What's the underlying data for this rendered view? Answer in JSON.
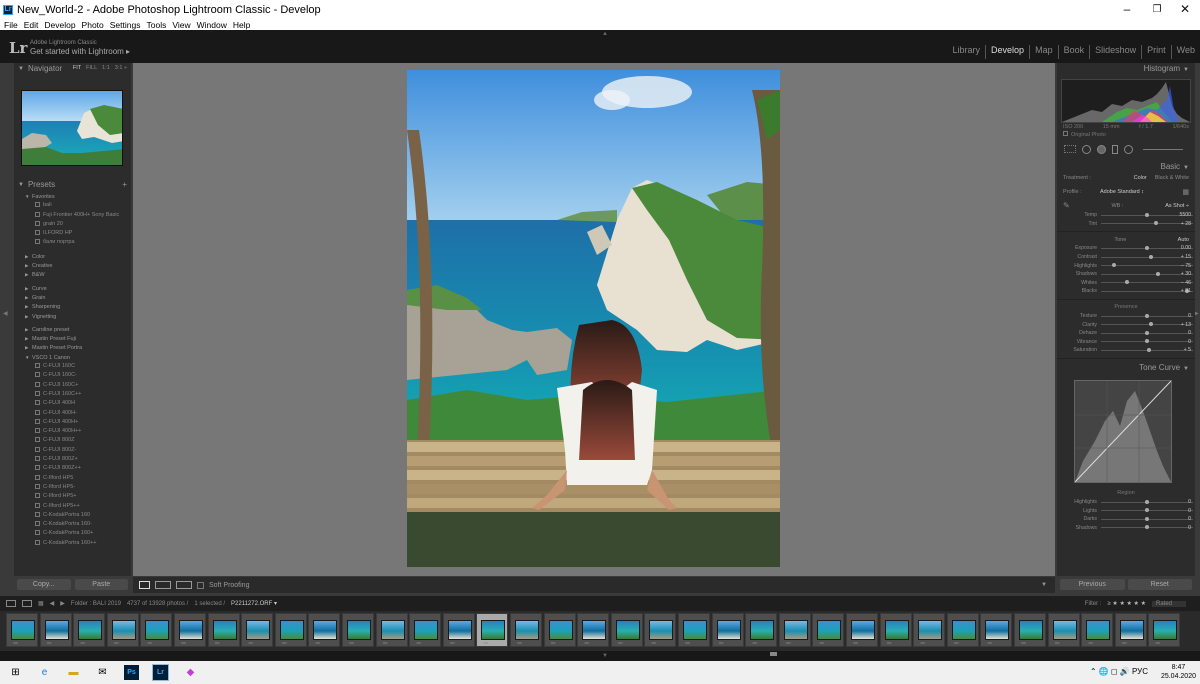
{
  "titlebar": {
    "icon": "Lr",
    "title": "New_World-2 - Adobe Photoshop Lightroom Classic - Develop",
    "minimize": "–",
    "maximize": "❐",
    "close": "✕"
  },
  "menu": [
    "File",
    "Edit",
    "Develop",
    "Photo",
    "Settings",
    "Tools",
    "View",
    "Window",
    "Help"
  ],
  "identity": {
    "logo": "Lr",
    "product": "Adobe Lightroom Classic",
    "cta": "Get started with Lightroom ▸"
  },
  "modules": [
    {
      "label": "Library",
      "active": false
    },
    {
      "label": "Develop",
      "active": true
    },
    {
      "label": "Map",
      "active": false
    },
    {
      "label": "Book",
      "active": false
    },
    {
      "label": "Slideshow",
      "active": false
    },
    {
      "label": "Print",
      "active": false
    },
    {
      "label": "Web",
      "active": false
    }
  ],
  "navigator": {
    "title": "Navigator",
    "opts": [
      "FIT",
      "FILL",
      "1:1",
      "3:1 ÷"
    ]
  },
  "presets": {
    "title": "Presets",
    "add": "+",
    "groups": [
      {
        "name": "Favorites",
        "open": true,
        "items": [
          "bali",
          "Fuji Frontier 400H+ Sony Basic",
          "grain 20",
          "ILFORD HP",
          "бали портра"
        ]
      },
      {
        "name": "Color",
        "open": false,
        "items": []
      },
      {
        "name": "Creative",
        "open": false,
        "items": []
      },
      {
        "name": "B&W",
        "open": false,
        "items": []
      },
      {
        "name": "Curve",
        "open": false,
        "items": []
      },
      {
        "name": "Grain",
        "open": false,
        "items": []
      },
      {
        "name": "Sharpening",
        "open": false,
        "items": []
      },
      {
        "name": "Vignetting",
        "open": false,
        "items": []
      },
      {
        "name": "Caroline preset",
        "open": false,
        "items": []
      },
      {
        "name": "Mastin Preset Fuji",
        "open": false,
        "items": []
      },
      {
        "name": "Mastin Preset Portra",
        "open": false,
        "items": []
      },
      {
        "name": "VSCO 1 Canon",
        "open": true,
        "items": [
          "C-FUJI 160C",
          "C-FUJI 160C-",
          "C-FUJI 160C+",
          "C-FUJI 160C++",
          "C-FUJI 400H",
          "C-FUJI 400H-",
          "C-FUJI 400H+",
          "C-FUJI 400H++",
          "C-FUJI 800Z",
          "C-FUJI 800Z-",
          "C-FUJI 800Z+",
          "C-FUJI 800Z++",
          "C-Ilford HP5",
          "C-Ilford HP5-",
          "C-Ilford HP5+",
          "C-Ilford HP5++",
          "C-KodakPortra 160",
          "C-KodakPortra 160-",
          "C-KodakPortra 160+",
          "C-KodakPortra 160++"
        ]
      }
    ]
  },
  "leftbuttons": {
    "copy": "Copy...",
    "paste": "Paste"
  },
  "toolbar": {
    "soft_proofing": "Soft Proofing",
    "view_icons": [
      "loupe",
      "before-after",
      "yy"
    ]
  },
  "histogram": {
    "title": "Histogram",
    "iso": "ISO 200",
    "focal": "15 mm",
    "aperture": "f / 1.7",
    "shutter": "1/640s",
    "original": "Original Photo"
  },
  "basic": {
    "title": "Basic",
    "treatment_label": "Treatment :",
    "treatment_color": "Color",
    "treatment_bw": "Black & White",
    "profile_label": "Profile :",
    "profile_value": "Adobe Standard ↕",
    "wb_label": "WB :",
    "wb_value": "As Shot ÷",
    "tone_label": "Tone",
    "tone_auto": "Auto",
    "presence_label": "Presence",
    "wb_sliders": [
      {
        "label": "Temp",
        "value": "5500",
        "pos": 0.5
      },
      {
        "label": "Tint",
        "value": "+ 28",
        "pos": 0.6
      }
    ],
    "tone_sliders": [
      {
        "label": "Exposure",
        "value": "0.00",
        "pos": 0.5
      },
      {
        "label": "Contrast",
        "value": "+ 15",
        "pos": 0.55
      },
      {
        "label": "Highlights",
        "value": "– 75",
        "pos": 0.12
      },
      {
        "label": "Shadows",
        "value": "+ 30",
        "pos": 0.62
      },
      {
        "label": "Whites",
        "value": "– 46",
        "pos": 0.27
      },
      {
        "label": "Blacks",
        "value": "+ 91",
        "pos": 0.95
      }
    ],
    "presence_sliders": [
      {
        "label": "Texture",
        "value": "0",
        "pos": 0.5
      },
      {
        "label": "Clarity",
        "value": "+ 13",
        "pos": 0.55
      },
      {
        "label": "Dehaze",
        "value": "0",
        "pos": 0.5
      },
      {
        "label": "Vibrance",
        "value": "0",
        "pos": 0.5
      },
      {
        "label": "Saturation",
        "value": "+ 5",
        "pos": 0.52
      }
    ]
  },
  "tonecurve": {
    "title": "Tone Curve",
    "region_label": "Region",
    "region_sliders": [
      {
        "label": "Highlights",
        "value": "0",
        "pos": 0.5
      },
      {
        "label": "Lights",
        "value": "0",
        "pos": 0.5
      },
      {
        "label": "Darks",
        "value": "0",
        "pos": 0.5
      },
      {
        "label": "Shadows",
        "value": "0",
        "pos": 0.5
      }
    ]
  },
  "rightbuttons": {
    "previous": "Previous",
    "reset": "Reset"
  },
  "filmbar": {
    "folder": "Folder : BALI 2019",
    "count": "4737 of 13928 photos /",
    "selected": "1 selected /",
    "filename": "P2211272.ORF ▾",
    "filter_label": "Filter :",
    "filter_value": "Rated"
  },
  "filmstrip": {
    "count": 35,
    "selected_index": 14
  },
  "taskbar": {
    "time": "8:47",
    "date": "25.04.2020",
    "lang": "РУС",
    "apps": [
      "windows",
      "edge",
      "explorer",
      "mail",
      "photoshop",
      "lightroom",
      "paint"
    ]
  },
  "colors": {
    "accent": "#31a8ff",
    "panel": "#2c2c2c",
    "dark": "#181818"
  }
}
